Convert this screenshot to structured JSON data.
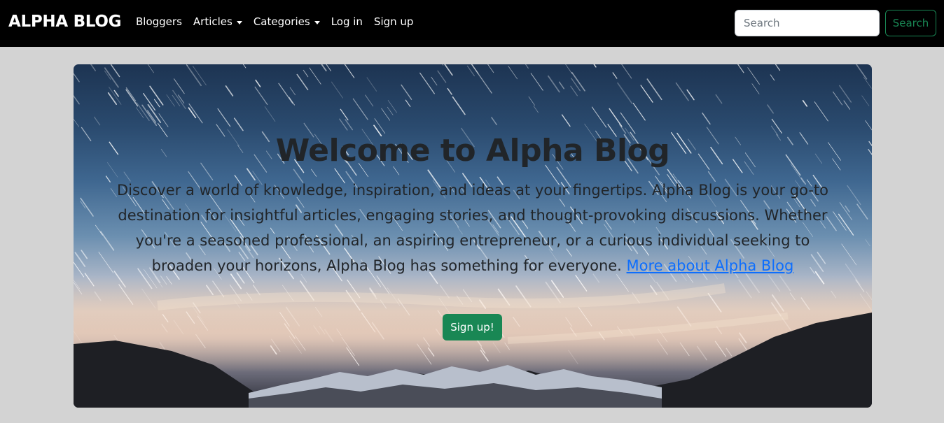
{
  "navbar": {
    "brand": "ALPHA BLOG",
    "links": [
      {
        "label": "Bloggers"
      },
      {
        "label": "Articles",
        "dropdown": true
      },
      {
        "label": "Categories",
        "dropdown": true
      },
      {
        "label": "Log in"
      },
      {
        "label": "Sign up"
      }
    ],
    "search": {
      "placeholder": "Search",
      "button_label": "Search"
    }
  },
  "hero": {
    "title": "Welcome to Alpha Blog",
    "description": "Discover a world of knowledge, inspiration, and ideas at your fingertips. Alpha Blog is your go-to destination for insightful articles, engaging stories, and thought-provoking discussions. Whether you're a seasoned professional, an aspiring entrepreneur, or a curious individual seeking to broaden your horizons, Alpha Blog has something for everyone.",
    "link_label": "More about Alpha Blog",
    "button_label": "Sign up!",
    "background": "starry-night-mountains-image"
  },
  "colors": {
    "navbar_bg": "#000000",
    "page_bg": "#d3d3d3",
    "accent_green": "#198754",
    "link_blue": "#0d6efd"
  }
}
